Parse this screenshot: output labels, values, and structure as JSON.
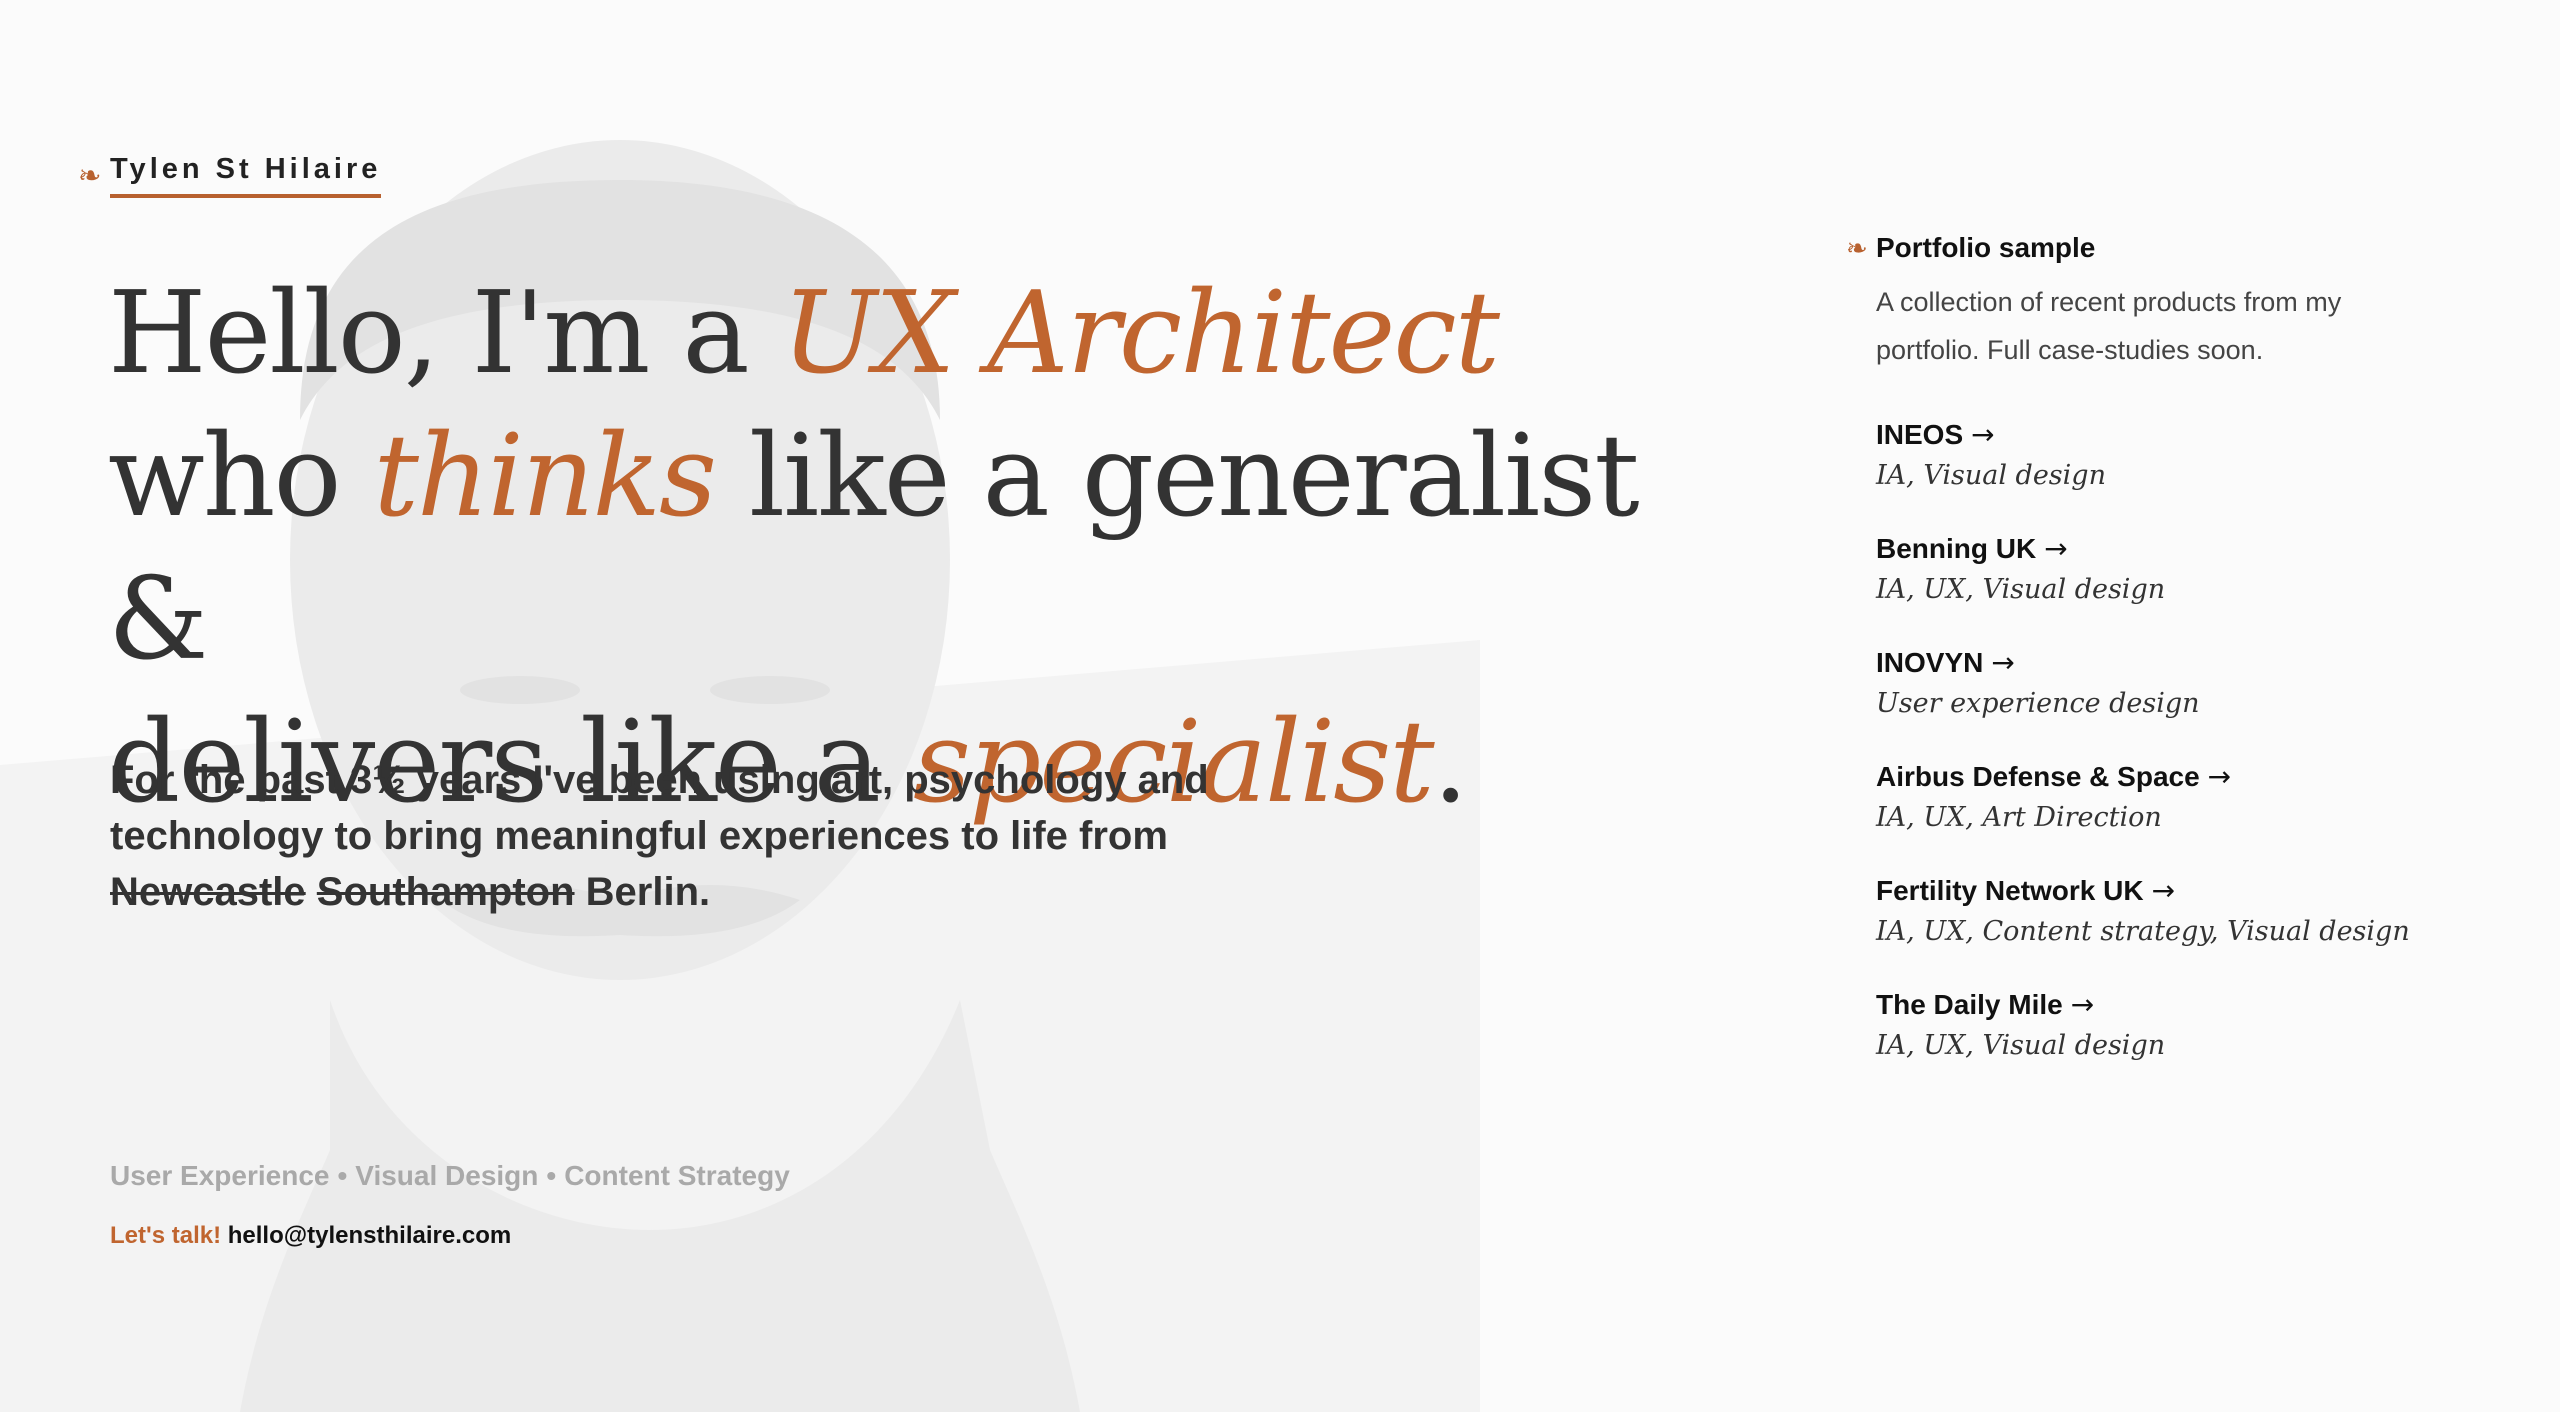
{
  "brand": {
    "mark": "❧",
    "name": "Tylen St Hilaire"
  },
  "hero": {
    "l1_a": "Hello, I'm a ",
    "l1_accent": "UX Architect",
    "l2_a": "who ",
    "l2_accent": "thinks",
    "l2_b": " like a generalist &",
    "l3_a": "delivers like a ",
    "l3_accent": "specialist",
    "l3_b": "."
  },
  "intro": {
    "text": "For the past 3½ years I've been using art, psychology and technology to bring meaningful experiences to life from ",
    "struck_1": "Newcastle",
    "struck_2": "Southampton",
    "current": "Berlin."
  },
  "skills": {
    "items": [
      "User Experience",
      "Visual Design",
      "Content Strategy"
    ],
    "separator": "•"
  },
  "contact": {
    "cta": "Let's talk!",
    "email": "hello@tylensthilaire.com"
  },
  "portfolio": {
    "mark": "❧",
    "title": "Portfolio sample",
    "description": "A collection of recent products from my portfolio. Full case-studies soon.",
    "arrow": "→",
    "projects": [
      {
        "name": "INEOS",
        "tags": "IA, Visual design"
      },
      {
        "name": "Benning UK",
        "tags": "IA, UX, Visual design"
      },
      {
        "name": "INOVYN",
        "tags": "User experience design"
      },
      {
        "name": "Airbus Defense & Space",
        "tags": "IA, UX, Art Direction"
      },
      {
        "name": "Fertility Network UK",
        "tags": "IA, UX, Content strategy, Visual design"
      },
      {
        "name": "The Daily Mile",
        "tags": "IA, UX, Visual design"
      }
    ]
  },
  "colors": {
    "accent": "#c0652f",
    "text": "#333333",
    "muted": "#a9a9a9",
    "background": "#fbfbfb"
  }
}
